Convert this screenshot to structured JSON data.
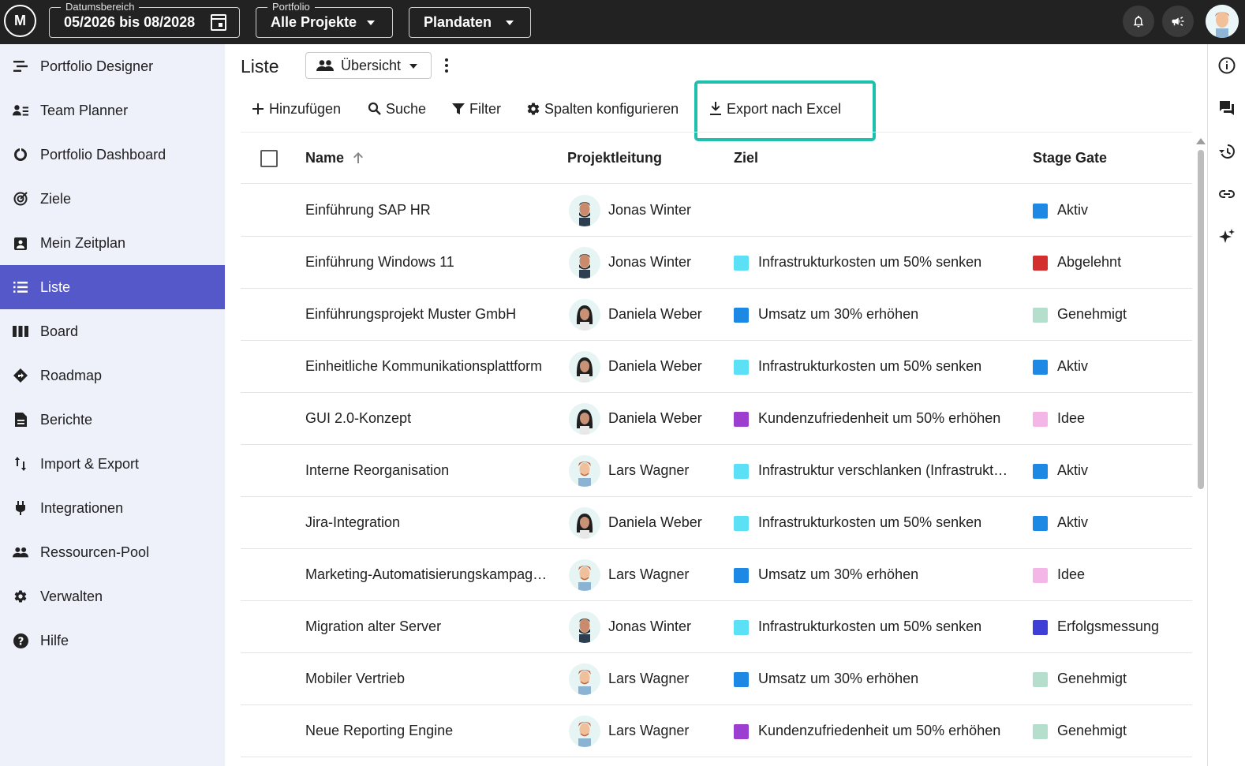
{
  "topbar": {
    "logo_text": "M",
    "date_range": {
      "legend": "Datumsbereich",
      "value": "05/2026 bis 08/2028"
    },
    "portfolio": {
      "legend": "Portfolio",
      "value": "Alle Projekte"
    },
    "dataset": {
      "value": "Plandaten"
    },
    "icons": [
      "bell-icon",
      "megaphone-icon",
      "user-avatar"
    ]
  },
  "sidebar": {
    "items": [
      {
        "label": "Portfolio Designer",
        "icon": "designer-icon"
      },
      {
        "label": "Team Planner",
        "icon": "team-icon"
      },
      {
        "label": "Portfolio Dashboard",
        "icon": "dashboard-icon"
      },
      {
        "label": "Ziele",
        "icon": "target-icon"
      },
      {
        "label": "Mein Zeitplan",
        "icon": "schedule-icon"
      },
      {
        "label": "Liste",
        "icon": "list-icon",
        "active": true
      },
      {
        "label": "Board",
        "icon": "board-icon"
      },
      {
        "label": "Roadmap",
        "icon": "roadmap-icon"
      },
      {
        "label": "Berichte",
        "icon": "report-icon"
      },
      {
        "label": "Import & Export",
        "icon": "import-export-icon"
      },
      {
        "label": "Integrationen",
        "icon": "plug-icon"
      },
      {
        "label": "Ressourcen-Pool",
        "icon": "people-icon"
      },
      {
        "label": "Verwalten",
        "icon": "gear-icon"
      },
      {
        "label": "Hilfe",
        "icon": "help-icon"
      }
    ]
  },
  "main": {
    "title": "Liste",
    "view_select": "Übersicht",
    "toolbar": {
      "add": "Hinzufügen",
      "search": "Suche",
      "filter": "Filter",
      "columns": "Spalten konfigurieren",
      "export": "Export nach Excel"
    }
  },
  "table": {
    "headers": {
      "name": "Name",
      "lead": "Projektleitung",
      "goal": "Ziel",
      "stage": "Stage Gate"
    },
    "rows": [
      {
        "name": "Einführung SAP HR",
        "lead": "Jonas Winter",
        "avatar": "jonas",
        "goal": "",
        "goal_color": "",
        "stage": "Aktiv",
        "stage_color": "#1e88e5"
      },
      {
        "name": "Einführung Windows 11",
        "lead": "Jonas Winter",
        "avatar": "jonas",
        "goal": "Infrastrukturkosten um 50% senken",
        "goal_color": "#5ce0f5",
        "stage": "Abgelehnt",
        "stage_color": "#d32f2f"
      },
      {
        "name": "Einführungsprojekt Muster GmbH",
        "lead": "Daniela Weber",
        "avatar": "daniela",
        "goal": "Umsatz um 30% erhöhen",
        "goal_color": "#1e88e5",
        "stage": "Genehmigt",
        "stage_color": "#b5dfcc"
      },
      {
        "name": "Einheitliche Kommunikationsplattform",
        "lead": "Daniela Weber",
        "avatar": "daniela",
        "goal": "Infrastrukturkosten um 50% senken",
        "goal_color": "#5ce0f5",
        "stage": "Aktiv",
        "stage_color": "#1e88e5"
      },
      {
        "name": "GUI 2.0-Konzept",
        "lead": "Daniela Weber",
        "avatar": "daniela",
        "goal": "Kundenzufriedenheit um 50% erhöhen",
        "goal_color": "#9c3fd1",
        "stage": "Idee",
        "stage_color": "#f3b6e6"
      },
      {
        "name": "Interne Reorganisation",
        "lead": "Lars Wagner",
        "avatar": "lars",
        "goal": "Infrastruktur verschlanken (Infrastrukt…",
        "goal_color": "#5ce0f5",
        "stage": "Aktiv",
        "stage_color": "#1e88e5"
      },
      {
        "name": "Jira-Integration",
        "lead": "Daniela Weber",
        "avatar": "daniela",
        "goal": "Infrastrukturkosten um 50% senken",
        "goal_color": "#5ce0f5",
        "stage": "Aktiv",
        "stage_color": "#1e88e5"
      },
      {
        "name": "Marketing-Automatisierungskampag…",
        "lead": "Lars Wagner",
        "avatar": "lars",
        "goal": "Umsatz um 30% erhöhen",
        "goal_color": "#1e88e5",
        "stage": "Idee",
        "stage_color": "#f3b6e6"
      },
      {
        "name": "Migration alter Server",
        "lead": "Jonas Winter",
        "avatar": "jonas",
        "goal": "Infrastrukturkosten um 50% senken",
        "goal_color": "#5ce0f5",
        "stage": "Erfolgsmessung",
        "stage_color": "#3f3fd8"
      },
      {
        "name": "Mobiler Vertrieb",
        "lead": "Lars Wagner",
        "avatar": "lars",
        "goal": "Umsatz um 30% erhöhen",
        "goal_color": "#1e88e5",
        "stage": "Genehmigt",
        "stage_color": "#b5dfcc"
      },
      {
        "name": "Neue Reporting Engine",
        "lead": "Lars Wagner",
        "avatar": "lars",
        "goal": "Kundenzufriedenheit um 50% erhöhen",
        "goal_color": "#9c3fd1",
        "stage": "Genehmigt",
        "stage_color": "#b5dfcc"
      }
    ]
  },
  "colors": {
    "accent": "#5458c8",
    "highlight": "#1fbfae",
    "topbar": "#222222"
  }
}
